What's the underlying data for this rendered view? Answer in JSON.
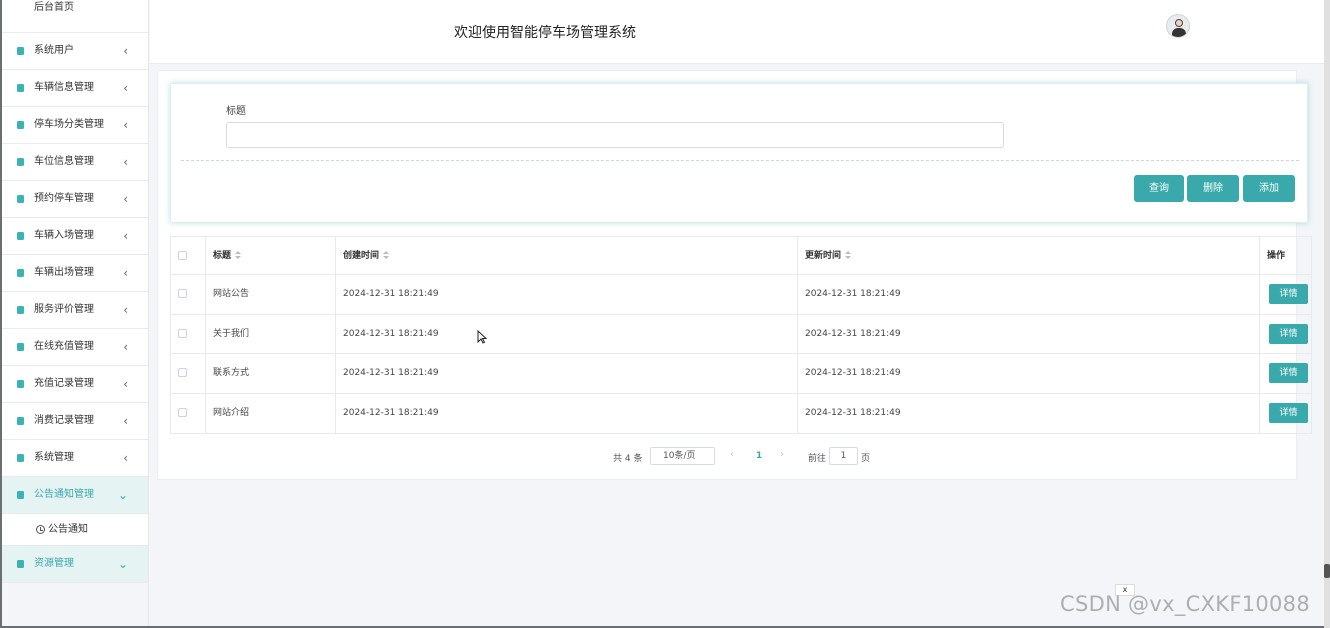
{
  "header": {
    "title": "欢迎使用智能停车场管理系统"
  },
  "sidebar": {
    "home": "后台首页",
    "items": [
      {
        "label": "系统用户"
      },
      {
        "label": "车辆信息管理"
      },
      {
        "label": "停车场分类管理"
      },
      {
        "label": "车位信息管理"
      },
      {
        "label": "预约停车管理"
      },
      {
        "label": "车辆入场管理"
      },
      {
        "label": "车辆出场管理"
      },
      {
        "label": "服务评价管理"
      },
      {
        "label": "在线充值管理"
      },
      {
        "label": "充值记录管理"
      },
      {
        "label": "消费记录管理"
      },
      {
        "label": "系统管理"
      },
      {
        "label": "公告通知管理"
      },
      {
        "label": "资源管理"
      }
    ],
    "sub_item": "公告通知"
  },
  "search": {
    "label": "标题",
    "value": "",
    "query_button": "查询",
    "delete_button": "删除",
    "add_button": "添加"
  },
  "table": {
    "headers": [
      "标题",
      "创建时间",
      "更新时间",
      "操作"
    ],
    "rows": [
      {
        "title": "网站公告",
        "created": "2024-12-31 18:21:49",
        "updated": "2024-12-31 18:21:49",
        "action": "详情"
      },
      {
        "title": "关于我们",
        "created": "2024-12-31 18:21:49",
        "updated": "2024-12-31 18:21:49",
        "action": "详情"
      },
      {
        "title": "联系方式",
        "created": "2024-12-31 18:21:49",
        "updated": "2024-12-31 18:21:49",
        "action": "详情"
      },
      {
        "title": "网站介绍",
        "created": "2024-12-31 18:21:49",
        "updated": "2024-12-31 18:21:49",
        "action": "详情"
      }
    ]
  },
  "pagination": {
    "total": "共 4 条",
    "page_size": "10条/页",
    "current_page": "1",
    "goto_label": "前往",
    "goto_value": "1",
    "page_suffix": "页"
  },
  "overlay": {
    "close": "x",
    "watermark": "CSDN @vx_CXKF10088"
  }
}
